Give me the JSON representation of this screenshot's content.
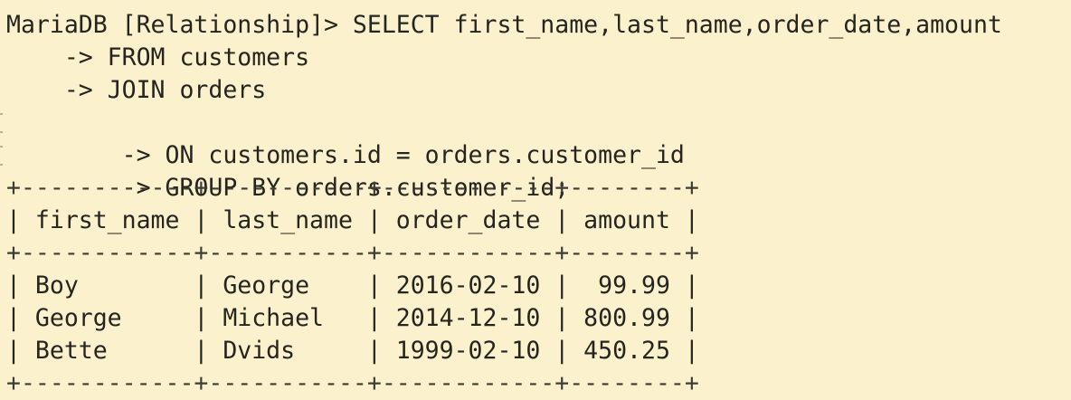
{
  "terminal": {
    "prompt_line": "MariaDB [Relationship]> SELECT first_name,last_name,order_date,amount",
    "query_lines": [
      "    -> FROM customers",
      "    -> JOIN orders",
      "    -> ON customers.id = orders.customer_id",
      "    -> GROUP BY orders.customer_id;"
    ],
    "table": {
      "border_line": "+------------+-----------+------------+--------+",
      "header_line": "| first_name | last_name | order_date | amount |",
      "columns": [
        "first_name",
        "last_name",
        "order_date",
        "amount"
      ],
      "rows": [
        {
          "line": "| Boy        | George    | 2016-02-10 |  99.99 |",
          "first_name": "Boy",
          "last_name": "George",
          "order_date": "2016-02-10",
          "amount": "99.99"
        },
        {
          "line": "| George     | Michael   | 2014-12-10 | 800.99 |",
          "first_name": "George",
          "last_name": "Michael",
          "order_date": "2014-12-10",
          "amount": "800.99"
        },
        {
          "line": "| Bette      | Dvids     | 1999-02-10 | 450.25 |",
          "first_name": "Bette",
          "last_name": "Dvids",
          "order_date": "1999-02-10",
          "amount": "450.25"
        }
      ]
    },
    "colors": {
      "background": "#fbf1cd",
      "text": "#24251f"
    }
  }
}
